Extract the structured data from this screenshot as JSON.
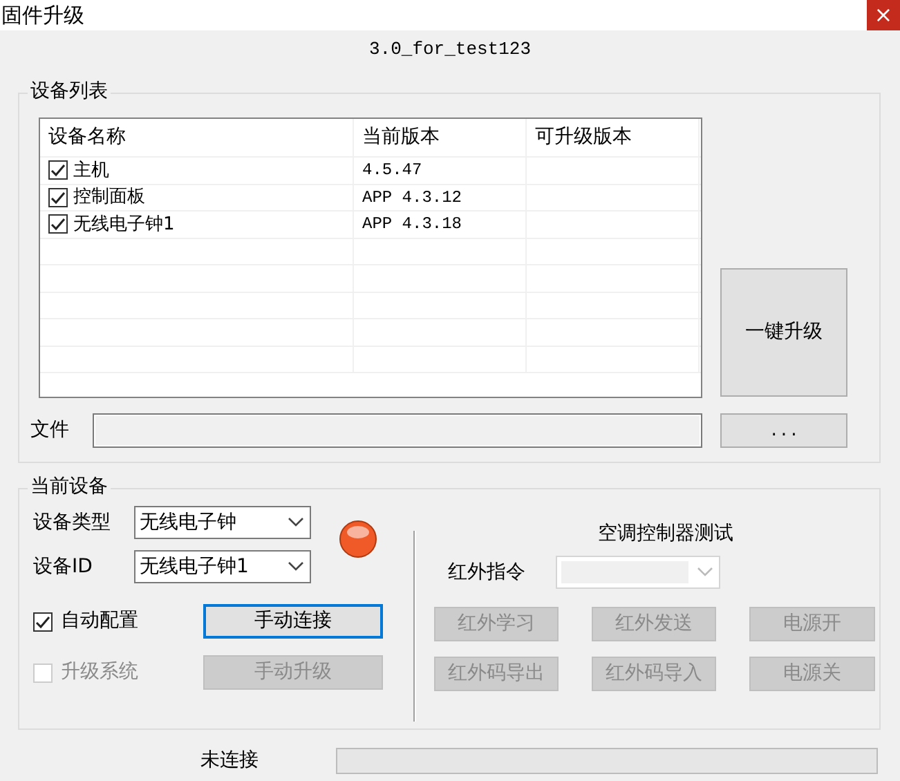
{
  "window": {
    "title": "固件升级",
    "close": "×",
    "subtitle": "3.0_for_test123"
  },
  "device_list": {
    "legend": "设备列表",
    "columns": [
      "设备名称",
      "当前版本",
      "可升级版本"
    ],
    "rows": [
      {
        "checked": true,
        "name": "主机",
        "current_version": "4.5.47"
      },
      {
        "checked": true,
        "name": "控制面板",
        "current_version": "APP 4.3.12"
      },
      {
        "checked": true,
        "name": "无线电子钟1",
        "current_version": "APP 4.3.18"
      }
    ],
    "upgrade_all_button": "一键升级",
    "file_label": "文件",
    "browse_button": "..."
  },
  "current_device": {
    "legend": "当前设备",
    "fields": [
      {
        "label": "设备类型",
        "value": "无线电子钟"
      },
      {
        "label": "设备ID",
        "value": "无线电子钟1"
      }
    ],
    "status_led": {
      "color": "#f05a28"
    },
    "options": [
      {
        "label": "自动配置",
        "checked": true,
        "disabled": false,
        "button": {
          "label": "手动连接",
          "disabled": false,
          "focused": true
        }
      },
      {
        "label": "升级系统",
        "checked": false,
        "disabled": true,
        "button": {
          "label": "手动升级",
          "disabled": true,
          "focused": false
        }
      }
    ],
    "ac_test": {
      "title": "空调控制器测试",
      "ir_command": {
        "label": "红外指令",
        "disabled": true
      },
      "buttons": [
        {
          "label": "红外学习",
          "disabled": true
        },
        {
          "label": "红外发送",
          "disabled": true
        },
        {
          "label": "电源开",
          "disabled": true
        },
        {
          "label": "红外码导出",
          "disabled": true
        },
        {
          "label": "红外码导入",
          "disabled": true
        },
        {
          "label": "电源关",
          "disabled": true
        }
      ]
    }
  },
  "status_bar": {
    "text": "未连接",
    "level": 0
  }
}
